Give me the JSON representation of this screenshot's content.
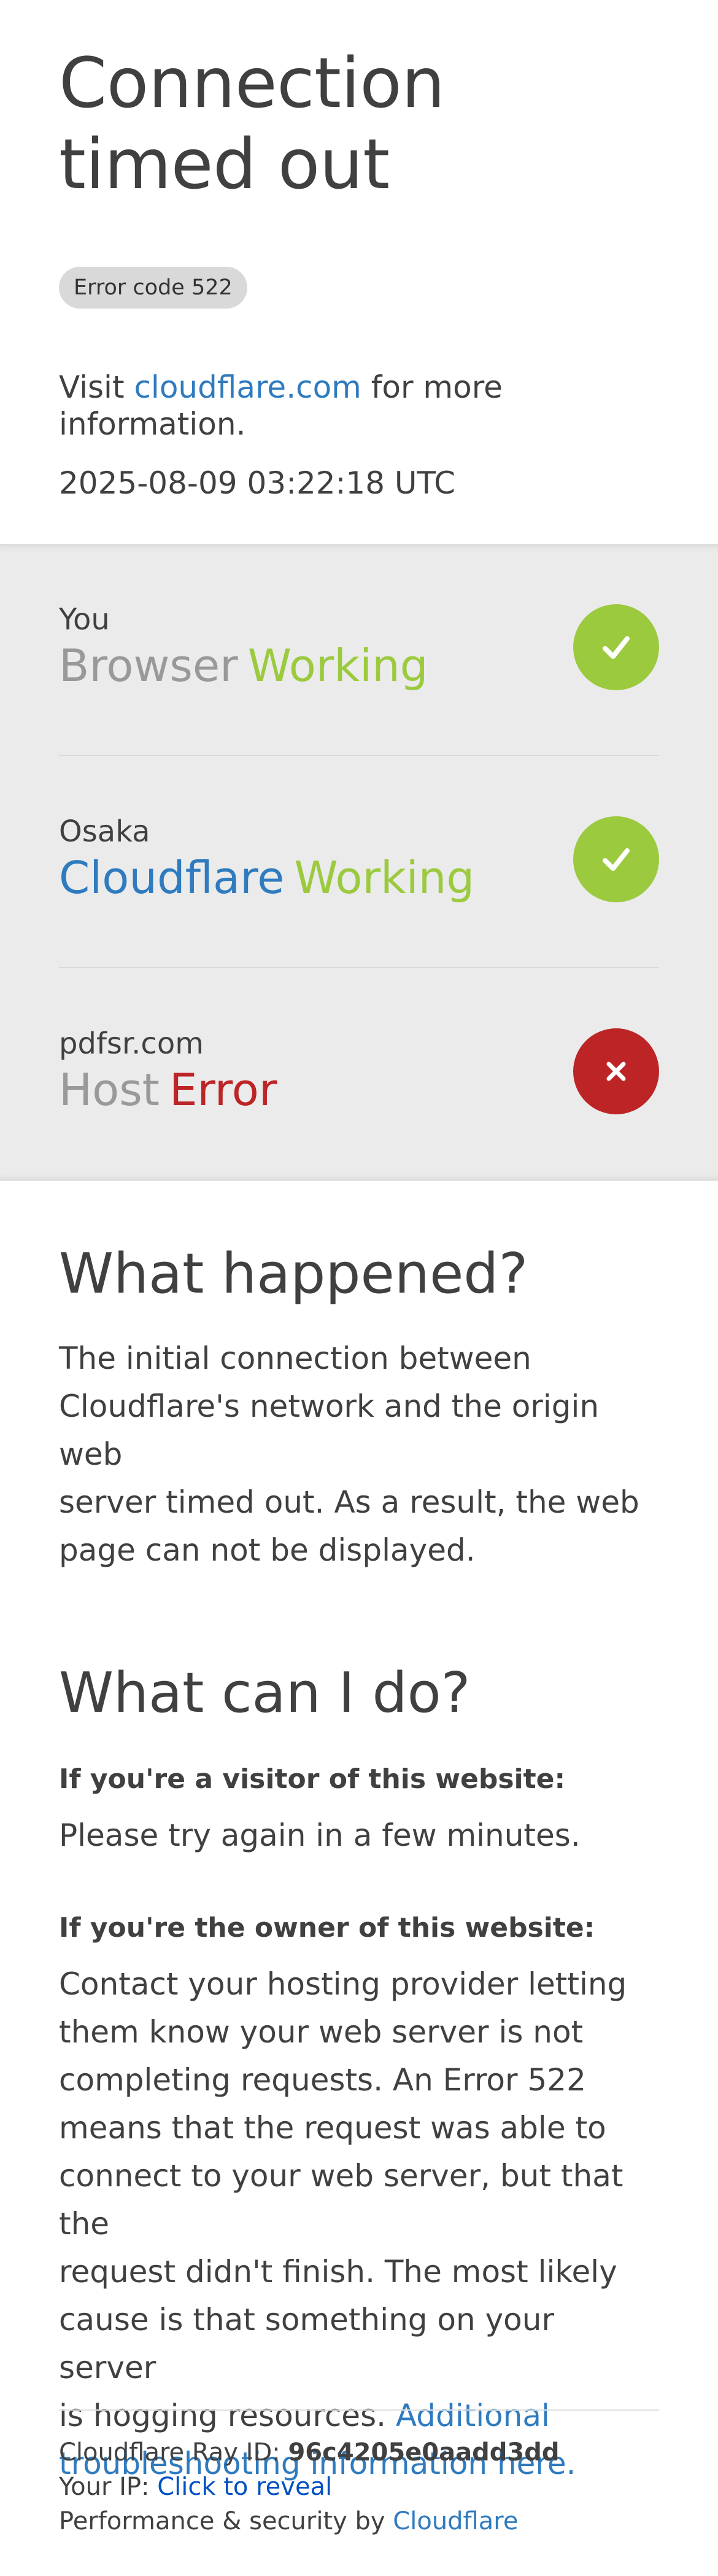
{
  "header": {
    "title_line1": "Connection",
    "title_line2": "timed out",
    "error_badge": "Error code 522",
    "visit_prefix": "Visit ",
    "visit_link": "cloudflare.com",
    "visit_suffix_1": " for more",
    "visit_suffix_2": "information.",
    "timestamp": "2025-08-09 03:22:18 UTC"
  },
  "status": [
    {
      "location": "You",
      "name": "Browser",
      "state": "Working",
      "icon": "check-icon"
    },
    {
      "location": "Osaka",
      "name": "Cloudflare",
      "state": "Working",
      "icon": "check-icon"
    },
    {
      "location": "pdfsr.com",
      "name": "Host",
      "state": "Error",
      "icon": "x-icon"
    }
  ],
  "what_happened": {
    "title": "What happened?",
    "lines": [
      "The initial connection between",
      "Cloudflare's network and the origin web",
      "server timed out. As a result, the web",
      "page can not be displayed."
    ]
  },
  "what_can_i_do": {
    "title": "What can I do?",
    "visitor_heading": "If you're a visitor of this website:",
    "visitor_text": "Please try again in a few minutes.",
    "owner_heading": "If you're the owner of this website:",
    "owner_lines": [
      "Contact your hosting provider letting",
      "them know your web server is not",
      "completing requests. An Error 522",
      "means that the request was able to",
      "connect to your web server, but that the",
      "request didn't finish. The most likely",
      "cause is that something on your server"
    ],
    "owner_last_prefix": "is hogging resources. ",
    "owner_link_1": "Additional",
    "owner_link_2": "troubleshooting information here."
  },
  "footer": {
    "ray_label": "Cloudflare Ray ID: ",
    "ray_id": "96c4205e0aadd3dd",
    "ip_label": "Your IP: ",
    "ip_link": "Click to reveal",
    "perf_label": "Performance & security by ",
    "perf_link": "Cloudflare"
  },
  "colors": {
    "accent_link": "#2f7bbf",
    "working": "#9bca3e",
    "error": "#bd2426",
    "band": "#ebebeb"
  }
}
